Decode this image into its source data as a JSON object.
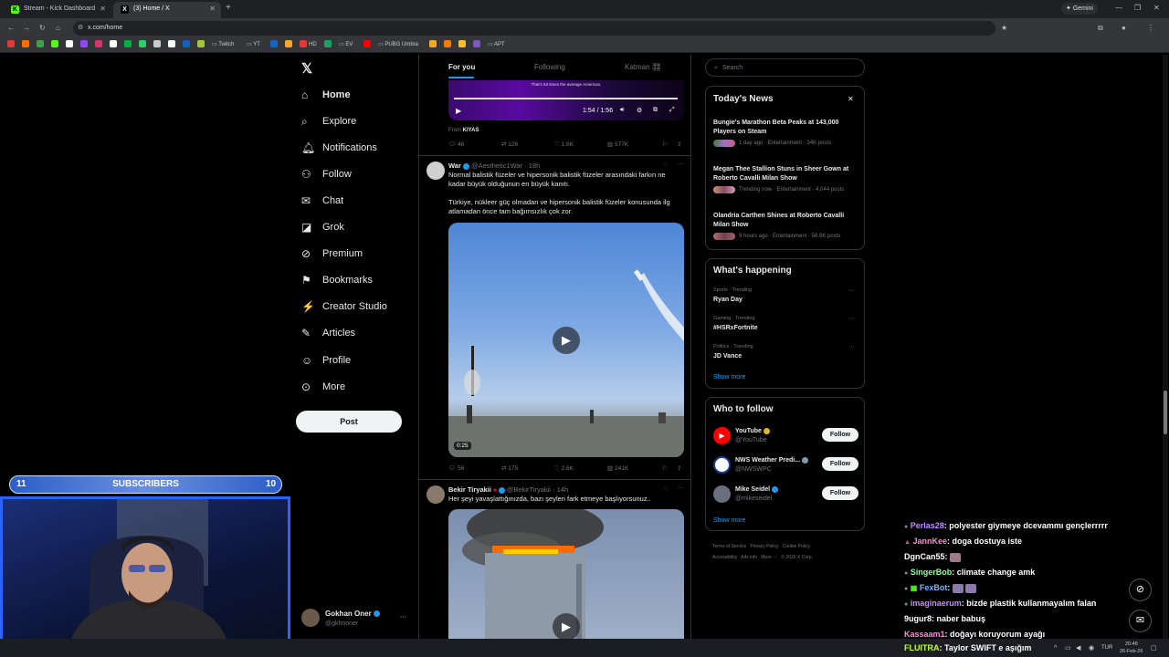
{
  "browser": {
    "tabs": [
      {
        "title": "Stream - Kick Dashboard",
        "icon": "kick-icon"
      },
      {
        "title": "(3) Home / X",
        "icon": "x-icon"
      }
    ],
    "gemini_label": "Gemini",
    "url": "x.com/home",
    "bookmarks": [
      "Twitch",
      "YT",
      "HD",
      "EV",
      "PUBG Umbra",
      "APT"
    ]
  },
  "nav": {
    "items": [
      {
        "label": "Home",
        "icon": "home-icon"
      },
      {
        "label": "Explore",
        "icon": "search-icon"
      },
      {
        "label": "Notifications",
        "icon": "bell-icon"
      },
      {
        "label": "Follow",
        "icon": "person-add-icon"
      },
      {
        "label": "Chat",
        "icon": "mail-icon"
      },
      {
        "label": "Grok",
        "icon": "grok-icon"
      },
      {
        "label": "Premium",
        "icon": "x-premium-icon"
      },
      {
        "label": "Bookmarks",
        "icon": "bookmark-icon"
      },
      {
        "label": "Creator Studio",
        "icon": "creator-icon"
      },
      {
        "label": "Articles",
        "icon": "articles-icon"
      },
      {
        "label": "Profile",
        "icon": "profile-icon"
      },
      {
        "label": "More",
        "icon": "more-icon"
      }
    ],
    "post_label": "Post",
    "account": {
      "name": "Gokhan Oner",
      "handle": "@gkhnoner"
    }
  },
  "feed": {
    "tabs": [
      "For you",
      "Following",
      "Katman 🎛"
    ],
    "video1": {
      "caption": "That's 53 times the average American.",
      "time": "1:54 / 1:56",
      "from_label": "From",
      "from": "KIYAS"
    },
    "tweet0_actions": {
      "replies": "46",
      "reposts": "126",
      "likes": "1.6K",
      "views": "577K"
    },
    "tweet1": {
      "name": "War",
      "handle": "@Aesthetic1War",
      "time": "· 18h",
      "text1": "Normal balistik füzeler ve hipersonik balistik füzeler arasındaki farkın ne kadar büyük olduğunun en büyük kanıtı.",
      "text2": "Türkiye, nükleer güç olmadan ve hipersonik balistik füzeler konusunda ilg atlamadan önce tam bağımsızlık çok zor.",
      "duration": "0:25",
      "replies": "56",
      "reposts": "175",
      "likes": "2.6K",
      "views": "241K"
    },
    "tweet2": {
      "name": "Bekir Tiryakii",
      "handle": "@BekirTiryakii",
      "time": "· 14h",
      "text": "Her şeyi yavaşlattığınızda, bazı şeyleri fark etmeye başlıyorsunuz.."
    }
  },
  "right": {
    "search_placeholder": "Search",
    "news": {
      "title": "Today's News",
      "items": [
        {
          "headline": "Bungie's Marathon Beta Peaks at 143,000 Players on Steam",
          "meta": "1 day ago · Entertainment · 34K posts"
        },
        {
          "headline": "Megan Thee Stallion Stuns in Sheer Gown at Roberto Cavalli Milan Show",
          "meta": "Trending now · Entertainment · 4,044 posts"
        },
        {
          "headline": "Olandria Carthen Shines at Roberto Cavalli Milan Show",
          "meta": "9 hours ago · Entertainment · 56.8K posts"
        }
      ]
    },
    "happening": {
      "title": "What's happening",
      "items": [
        {
          "category": "Sports · Trending",
          "topic": "Ryan Day"
        },
        {
          "category": "Gaming · Trending",
          "topic": "#HSRxFortnite"
        },
        {
          "category": "Politics · Trending",
          "topic": "JD Vance"
        }
      ],
      "show_more": "Show more"
    },
    "who_to_follow": {
      "title": "Who to follow",
      "items": [
        {
          "name": "YouTube",
          "handle": "@YouTube"
        },
        {
          "name": "NWS Weather Predi...",
          "handle": "@NWSWPC"
        },
        {
          "name": "Mike Seidel",
          "handle": "@mikeseidel"
        }
      ],
      "follow_label": "Follow",
      "show_more": "Show more"
    },
    "footer": [
      "Terms of Service",
      "Privacy Policy",
      "Cookie Policy",
      "Accessibility",
      "Ads info",
      "More ···",
      "© 2026 X Corp."
    ]
  },
  "overlay": {
    "sub_left": "11",
    "sub_label": "SUBSCRIBERS",
    "sub_right": "10",
    "chat": [
      {
        "user": "Perlas28",
        "msg": ": polyester giymeye dcevammı gençlerrrrr",
        "color": "#c58bff"
      },
      {
        "user": "JannKee",
        "msg": ": doga dostuya iste",
        "color": "#ff8bd2"
      },
      {
        "user": "DgnCan55",
        "msg": ":",
        "color": "#ffffff"
      },
      {
        "user": "SingerBob",
        "msg": ": climate change amk",
        "color": "#8bff9a"
      },
      {
        "user": "FexBot",
        "msg": ":",
        "color": "#6fb6ff"
      },
      {
        "user": "imaginaerum",
        "msg": ": bizde plastik kullanmayalım falan",
        "color": "#c58bff"
      },
      {
        "user": "9ugur8",
        "msg": ": naber babuş",
        "color": "#ffffff"
      },
      {
        "user": "Kassaam1",
        "msg": ": doğayı koruyorum ayağı",
        "color": "#ff8bd2"
      },
      {
        "user": "FLUITRA",
        "msg": ": Taylor SWIFT e aşığım",
        "color": "#c4ff3a"
      }
    ]
  },
  "taskbar": {
    "lang": "TUR",
    "time": "20:48",
    "date": "26-Feb-26"
  }
}
